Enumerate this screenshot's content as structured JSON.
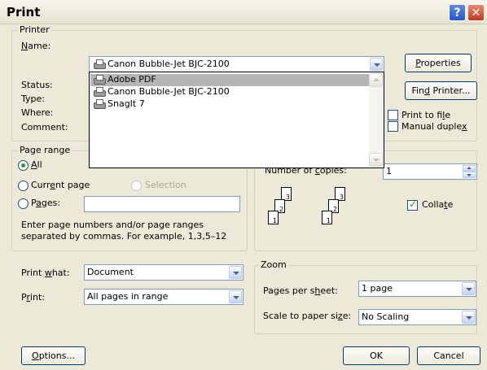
{
  "window": {
    "title": "Print",
    "help_glyph": "?",
    "close_glyph": "✕"
  },
  "printer": {
    "legend": "Printer",
    "name_label_pre": "",
    "name_label_u": "N",
    "name_label_post": "ame:",
    "selected": "Canon Bubble-Jet BJC-2100",
    "options": [
      "Adobe PDF",
      "Canon Bubble-Jet BJC-2100",
      "SnagIt 7"
    ],
    "status_label": "Status:",
    "type_label": "Type:",
    "where_label": "Where:",
    "comment_label": "Comment:",
    "properties_pre": "",
    "properties_u": "P",
    "properties_post": "roperties",
    "find_pre": "Fin",
    "find_u": "d",
    "find_post": " Printer...",
    "print_to_file_pre": "Print to fi",
    "print_to_file_u": "l",
    "print_to_file_post": "e",
    "manual_duplex_pre": "Manual duple",
    "manual_duplex_u": "x",
    "manual_duplex_post": ""
  },
  "page_range": {
    "legend": "Page range",
    "all_pre": "",
    "all_u": "A",
    "all_post": "ll",
    "current_pre": "Curr",
    "current_u": "e",
    "current_post": "nt page",
    "selection": "Selection",
    "pages_pre": "P",
    "pages_u": "a",
    "pages_post": "ges:",
    "pages_value": "",
    "hint_line1": "Enter page numbers and/or page ranges",
    "hint_line2": "separated by commas.  For example, 1,3,5–12"
  },
  "copies": {
    "label_pre": "Number of ",
    "label_u": "c",
    "label_post": "opies:",
    "value": "1",
    "collate_pre": "Colla",
    "collate_u": "t",
    "collate_post": "e",
    "pages": [
      "3",
      "2",
      "1"
    ]
  },
  "print_what": {
    "label_pre": "Print ",
    "label_u": "w",
    "label_post": "hat:",
    "value": "Document"
  },
  "print": {
    "label_pre": "P",
    "label_u": "r",
    "label_post": "int:",
    "value": "All pages in range"
  },
  "zoom": {
    "legend": "Zoom",
    "pps_pre": "Pages per s",
    "pps_u": "h",
    "pps_post": "eet:",
    "pps_value": "1 page",
    "scale_pre": "Scale to paper si",
    "scale_u": "z",
    "scale_post": "e:",
    "scale_value": "No Scaling"
  },
  "buttons": {
    "options_pre": "",
    "options_u": "O",
    "options_post": "ptions...",
    "ok": "OK",
    "cancel": "Cancel"
  }
}
